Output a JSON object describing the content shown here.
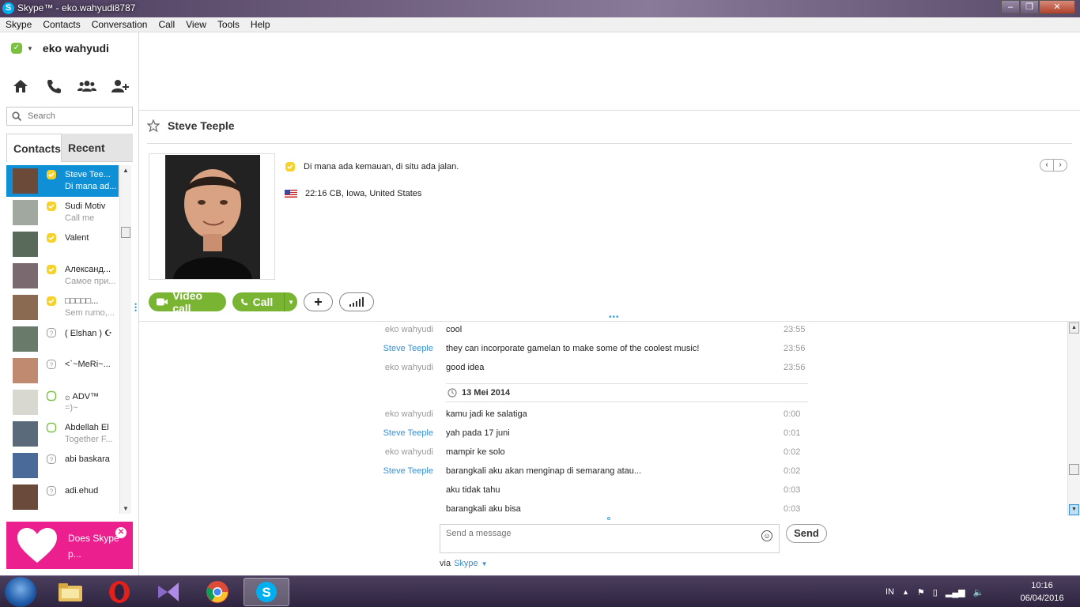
{
  "window": {
    "title": "Skype™ - eko.wahyudi8787",
    "minimize": "–",
    "maximize": "❐",
    "close": "✕"
  },
  "menu": [
    "Skype",
    "Contacts",
    "Conversation",
    "Call",
    "View",
    "Tools",
    "Help"
  ],
  "profile": {
    "name": "eko wahyudi"
  },
  "search": {
    "placeholder": "Search"
  },
  "tabs": {
    "contacts": "Contacts",
    "recent": "Recent"
  },
  "contacts": [
    {
      "name": "Steve Tee...",
      "mood": "Di mana ad...",
      "status": "skype-yellow",
      "selected": true
    },
    {
      "name": "Sudi Motiv",
      "mood": "Call me",
      "status": "skype-yellow"
    },
    {
      "name": "Valent",
      "mood": "",
      "status": "skype-yellow"
    },
    {
      "name": "Александ...",
      "mood": "Самое при...",
      "status": "skype-yellow"
    },
    {
      "name": "□□□□□...",
      "mood": "Sem rumo,...",
      "status": "skype-yellow"
    },
    {
      "name": "( Elshan ) ☪",
      "mood": "",
      "status": "offline"
    },
    {
      "name": "<`~MeRi~...",
      "mood": "",
      "status": "offline"
    },
    {
      "name": "۞ ADV™",
      "mood": "=)~",
      "status": "green-outline"
    },
    {
      "name": "Abdellah El",
      "mood": "Together F...",
      "status": "green-outline"
    },
    {
      "name": "abi baskara",
      "mood": "",
      "status": "offline"
    },
    {
      "name": "adi.ehud",
      "mood": "",
      "status": "offline"
    }
  ],
  "ad": {
    "text": "Does Skype p...",
    "close": "✕"
  },
  "conversation": {
    "contact_name": "Steve Teeple",
    "mood": "Di mana ada kemauan, di situ ada jalan.",
    "location": "22:16 CB, Iowa, United States",
    "nav_prev": "‹",
    "nav_next": "›",
    "video_call": "Video call",
    "call": "Call",
    "add": "+",
    "divider": "•••"
  },
  "messages": [
    {
      "author": "eko wahyudi",
      "text": "cool",
      "time": "23:55",
      "self": true
    },
    {
      "author": "Steve Teeple",
      "text": "they can incorporate gamelan to make some of the coolest music!",
      "time": "23:56",
      "self": false
    },
    {
      "author": "eko wahyudi",
      "text": "good idea",
      "time": "23:56",
      "self": true
    },
    {
      "author": "eko wahyudi",
      "text": "kamu jadi ke salatiga",
      "time": "0:00",
      "self": true
    },
    {
      "author": "Steve Teeple",
      "text": "yah pada 17 juni",
      "time": "0:01",
      "self": false
    },
    {
      "author": "eko wahyudi",
      "text": "mampir ke solo",
      "time": "0:02",
      "self": true
    },
    {
      "author": "Steve Teeple",
      "text": "barangkali aku akan menginap di semarang atau...",
      "time": "0:02",
      "self": false
    },
    {
      "author": "",
      "text": "aku tidak tahu",
      "time": "0:03",
      "self": false
    },
    {
      "author": "",
      "text": "barangkali aku bisa",
      "time": "0:03",
      "self": false
    }
  ],
  "date_separator": "13 Mei 2014",
  "compose": {
    "placeholder": "Send a message",
    "send": "Send",
    "via_label": "via",
    "via_service": "Skype"
  },
  "taskbar": {
    "apps": [
      "windows-explorer",
      "opera",
      "visual-studio",
      "chrome",
      "skype"
    ],
    "language": "IN",
    "time": "10:16",
    "date": "06/04/2016"
  },
  "colors": {
    "skype_blue": "#00aff0",
    "call_green": "#7ab433",
    "selection_blue": "#0f8fd6",
    "ad_pink": "#ec1f8f"
  }
}
